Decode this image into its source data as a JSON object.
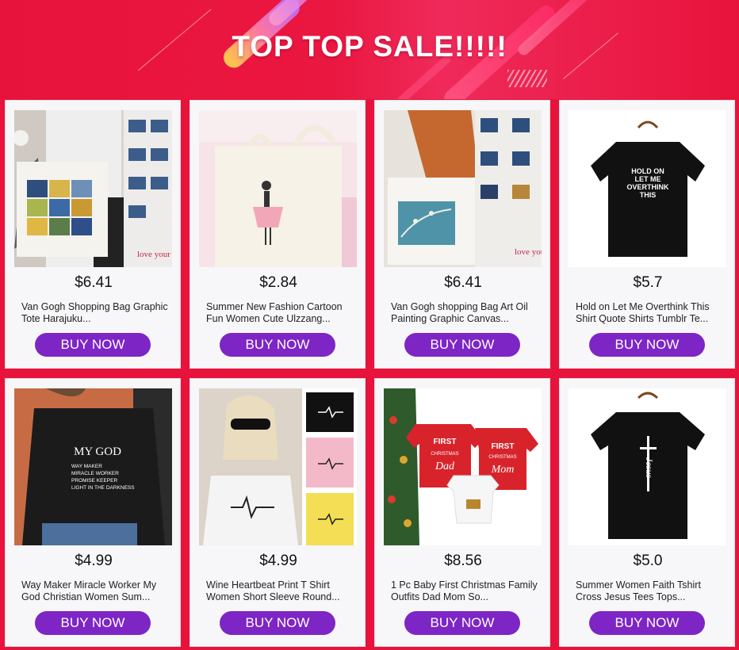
{
  "banner": {
    "title": "TOP TOP SALE!!!!!"
  },
  "accent_color": "#7e25c6",
  "background_color": "#e8133c",
  "products": [
    {
      "price": "$6.41",
      "title": "Van Gogh Shopping Bag Graphic Tote Harajuku...",
      "button": "BUY NOW",
      "image": "van-gogh-tote-bag-photo"
    },
    {
      "price": "$2.84",
      "title": "Summer New Fashion Cartoon Fun Women Cute Ulzzang...",
      "button": "BUY NOW",
      "image": "cartoon-girl-tote-bag-photo"
    },
    {
      "price": "$6.41",
      "title": "Van Gogh shopping Bag Art Oil Painting Graphic Canvas...",
      "button": "BUY NOW",
      "image": "almond-blossom-tote-bag-photo"
    },
    {
      "price": "$5.7",
      "title": "Hold on Let Me Overthink This Shirt Quote Shirts Tumblr Te...",
      "button": "BUY NOW",
      "image": "overthink-tshirt-photo",
      "shirt_text": "HOLD ON\nLET ME\nOVERTHINK\nTHIS"
    },
    {
      "price": "$4.99",
      "title": "Way Maker Miracle Worker My God Christian Women Sum...",
      "button": "BUY NOW",
      "image": "my-god-tshirt-photo",
      "shirt_text": "MY GOD",
      "shirt_subtext": [
        "WAY MAKER",
        "MIRACLE WORKER",
        "PROMISE KEEPER",
        "LIGHT IN THE DARKNESS"
      ]
    },
    {
      "price": "$4.99",
      "title": "Wine Heartbeat Print T Shirt Women Short Sleeve Round...",
      "button": "BUY NOW",
      "image": "wine-heartbeat-tshirt-photo"
    },
    {
      "price": "$8.56",
      "title": "1 Pc Baby First Christmas Family Outfits Dad Mom So...",
      "button": "BUY NOW",
      "image": "first-christmas-family-shirts-photo",
      "shirt_text": [
        "FIRST CHRISTMAS AS Dad",
        "FIRST CHRISTMAS AS Mom"
      ]
    },
    {
      "price": "$5.0",
      "title": "Summer Women Faith Tshirt Cross Jesus Tees Tops...",
      "button": "BUY NOW",
      "image": "jesus-cross-tshirt-photo",
      "shirt_text": "Jesus"
    }
  ]
}
